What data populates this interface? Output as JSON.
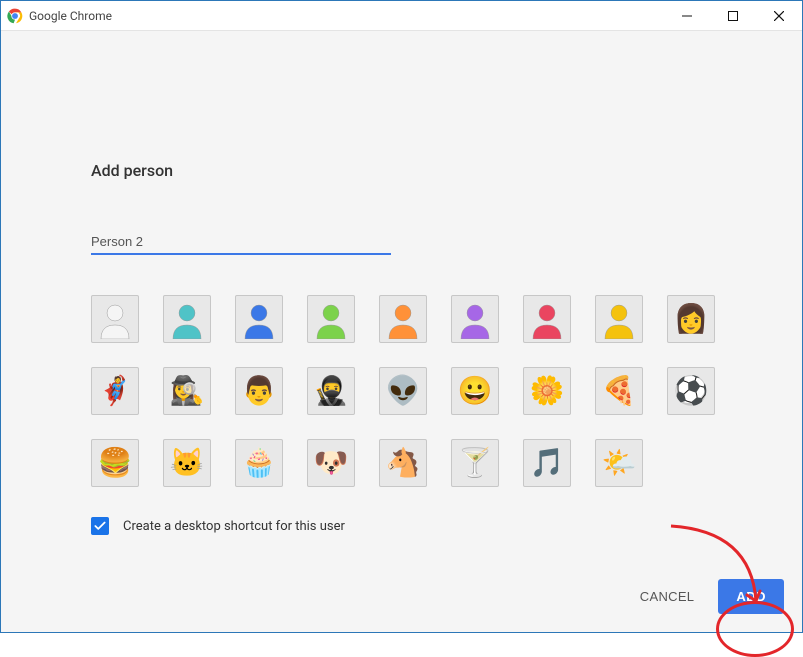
{
  "window": {
    "title": "Google Chrome"
  },
  "dialog": {
    "heading": "Add person",
    "name_value": "Person 2",
    "checkbox_label": "Create a desktop shortcut for this user",
    "checkbox_checked": true
  },
  "avatars": [
    {
      "name": "default-silhouette",
      "icon": "👤"
    },
    {
      "name": "teal-silhouette",
      "icon": "👤"
    },
    {
      "name": "blue-silhouette",
      "icon": "👤"
    },
    {
      "name": "green-silhouette",
      "icon": "👤"
    },
    {
      "name": "orange-silhouette",
      "icon": "👤"
    },
    {
      "name": "purple-silhouette",
      "icon": "👤"
    },
    {
      "name": "red-silhouette",
      "icon": "👤"
    },
    {
      "name": "yellow-silhouette",
      "icon": "👤"
    },
    {
      "name": "female-sunglasses",
      "icon": "👩"
    },
    {
      "name": "hero-male",
      "icon": "🦸"
    },
    {
      "name": "agent-female",
      "icon": "🕵️‍♀️"
    },
    {
      "name": "man",
      "icon": "👨"
    },
    {
      "name": "ninja",
      "icon": "🥷"
    },
    {
      "name": "alien",
      "icon": "👽"
    },
    {
      "name": "smiley",
      "icon": "😀"
    },
    {
      "name": "flower",
      "icon": "🌼"
    },
    {
      "name": "pizza",
      "icon": "🍕"
    },
    {
      "name": "soccer-ball",
      "icon": "⚽"
    },
    {
      "name": "burger",
      "icon": "🍔"
    },
    {
      "name": "cat",
      "icon": "🐱"
    },
    {
      "name": "cupcake",
      "icon": "🧁"
    },
    {
      "name": "dog",
      "icon": "🐶"
    },
    {
      "name": "horse",
      "icon": "🐴"
    },
    {
      "name": "cocktail",
      "icon": "🍸"
    },
    {
      "name": "music-note",
      "icon": "🎵"
    },
    {
      "name": "sun-cloud",
      "icon": "🌤️"
    }
  ],
  "silhouette_colors": [
    "#f5f5f5",
    "#4fc3c7",
    "#3b78e7",
    "#7cd24b",
    "#ff9138",
    "#a667e6",
    "#ea4560",
    "#f4c20d"
  ],
  "buttons": {
    "cancel": "CANCEL",
    "add": "ADD"
  },
  "colors": {
    "accent": "#3b78e7",
    "annotation": "#e3262a"
  }
}
